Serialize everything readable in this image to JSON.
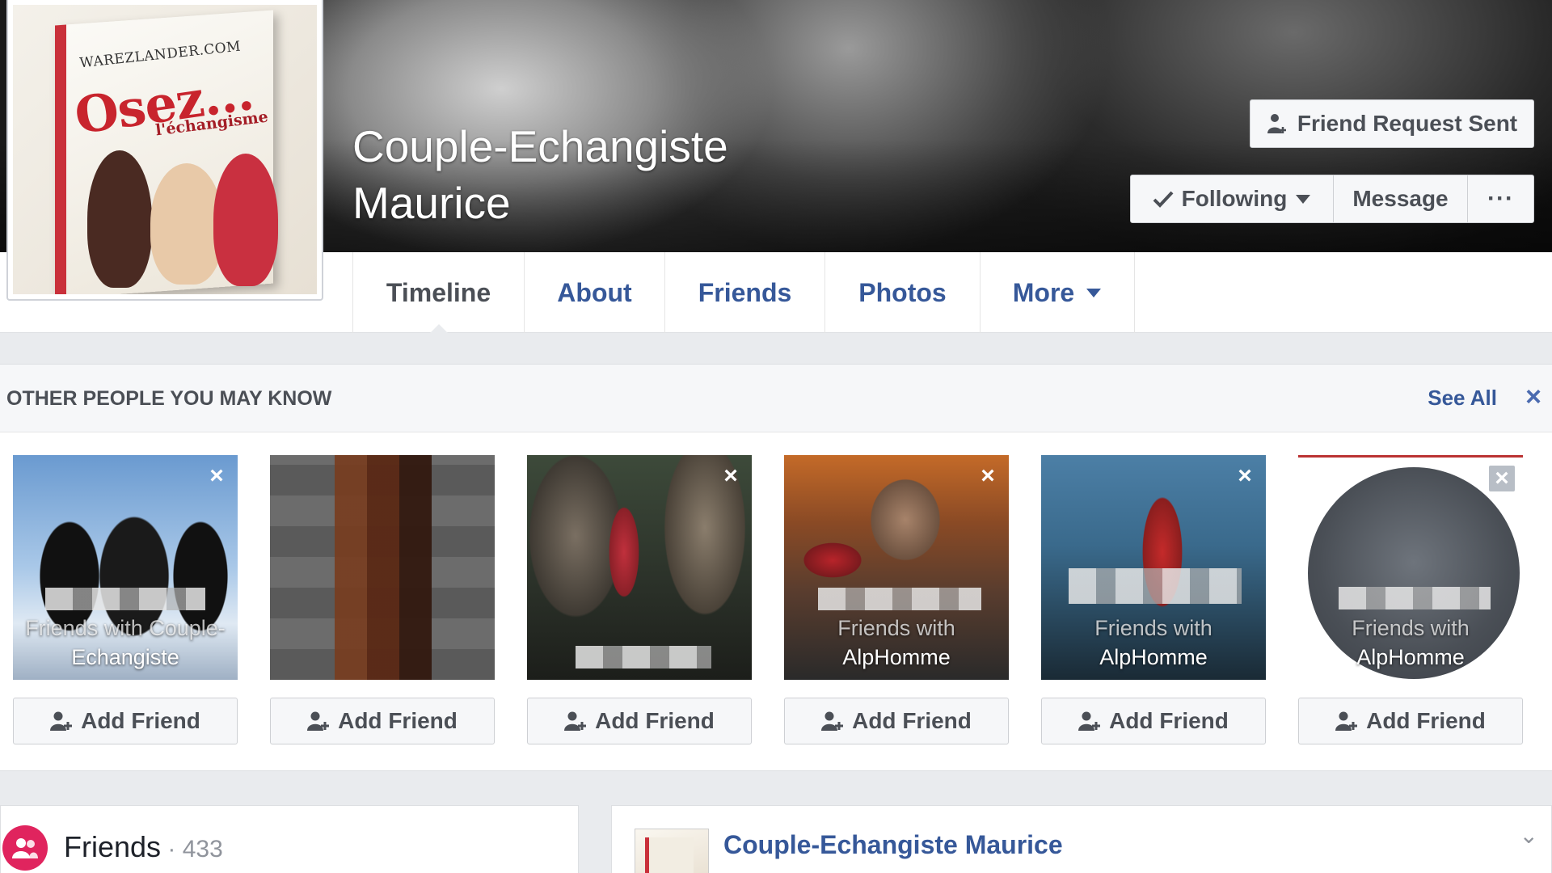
{
  "profile": {
    "name_line1": "Couple-Echangiste",
    "name_line2": "Maurice",
    "picture_icon": "book-cover-image",
    "picture_text": {
      "site": "WAREZLANDER.COM",
      "title": "Osez...",
      "subtitle": "l'échangisme"
    }
  },
  "actions": {
    "friend_request": "Friend Request Sent",
    "following": "Following",
    "message": "Message",
    "more": "···"
  },
  "nav": {
    "tabs": [
      {
        "label": "Timeline",
        "active": true
      },
      {
        "label": "About"
      },
      {
        "label": "Friends"
      },
      {
        "label": "Photos"
      },
      {
        "label": "More"
      }
    ]
  },
  "pymk": {
    "title": "OTHER PEOPLE YOU MAY KNOW",
    "see_all": "See All",
    "close": "×",
    "cards": [
      {
        "line1": "Friends with Couple-",
        "line2": "Echangiste",
        "button": "Add Friend",
        "close": "×"
      },
      {
        "line1": "",
        "line2": "",
        "button": "Add Friend",
        "close": ""
      },
      {
        "line1": "",
        "line2": "",
        "button": "Add Friend",
        "close": "×"
      },
      {
        "line1": "Friends with",
        "line2": "AlpHomme",
        "button": "Add Friend",
        "close": "×"
      },
      {
        "line1": "Friends with",
        "line2": "AlpHomme",
        "button": "Add Friend",
        "close": "×"
      },
      {
        "line1": "Friends with",
        "line2": "AlpHomme",
        "button": "Add Friend",
        "close": "×"
      }
    ]
  },
  "friends_section": {
    "title": "Friends",
    "count": " · 433"
  },
  "post": {
    "author": "Couple-Echangiste Maurice",
    "chevron": "⌄"
  },
  "colors": {
    "link_blue": "#365899",
    "page_bg": "#e9ebee",
    "friends_icon_bg": "#e0245e"
  }
}
